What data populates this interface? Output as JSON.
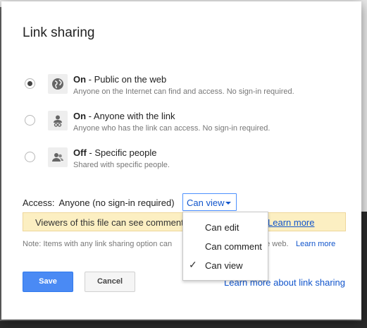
{
  "dialog": {
    "title": "Link sharing",
    "options": [
      {
        "strong": "On",
        "title_rest": " - Public on the web",
        "description": "Anyone on the Internet can find and access. No sign-in required.",
        "icon": "globe-icon",
        "selected": true
      },
      {
        "strong": "On",
        "title_rest": " - Anyone with the link",
        "description": "Anyone who has the link can access. No sign-in required.",
        "icon": "link-person-icon",
        "selected": false
      },
      {
        "strong": "Off",
        "title_rest": " - Specific people",
        "description": "Shared with specific people.",
        "icon": "people-icon",
        "selected": false
      }
    ],
    "access": {
      "label": "Access:",
      "who": "Anyone (no sign-in required)",
      "permission": "Can view"
    },
    "notice": {
      "text": "Viewers of this file can see comment",
      "link": "Learn more"
    },
    "note": {
      "text": "Note: Items with any link sharing option can",
      "text_end": "he web.",
      "link": "Learn more"
    },
    "buttons": {
      "save": "Save",
      "cancel": "Cancel"
    },
    "learn_more_link": "Learn more about link sharing",
    "permission_menu": {
      "items": [
        "Can edit",
        "Can comment",
        "Can view"
      ],
      "checked": "✓"
    }
  },
  "colors": {
    "primary": "#4a8af4",
    "link": "#1155cc",
    "notice_bg": "#fcefc2"
  }
}
